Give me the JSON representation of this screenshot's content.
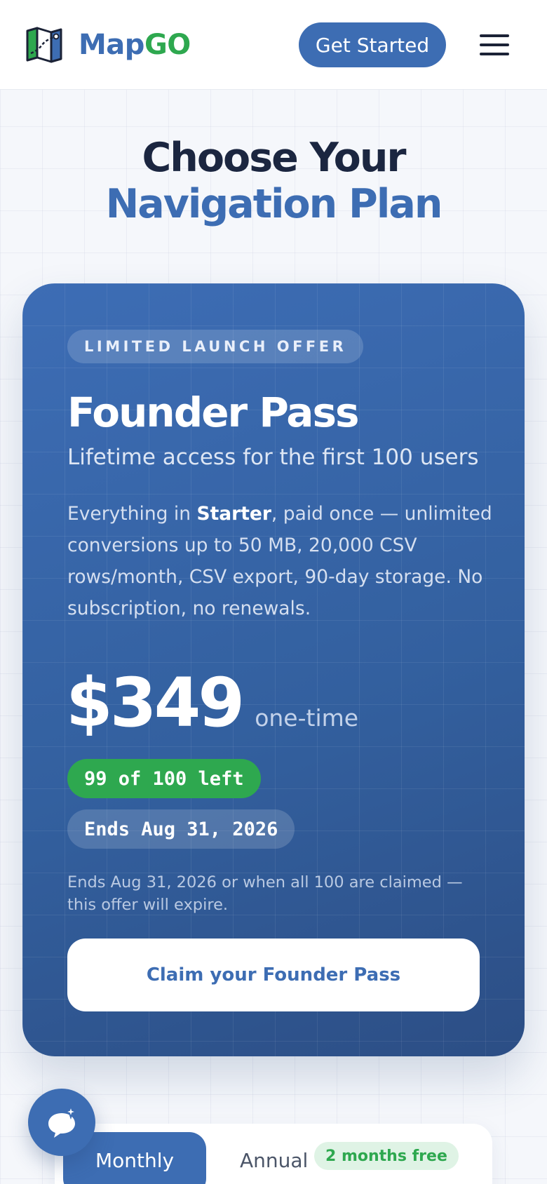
{
  "header": {
    "brand_part1": "Map",
    "brand_part2": "GO",
    "get_started_label": "Get Started"
  },
  "page": {
    "title_part1": "Choose Your ",
    "title_part2": "Navigation Plan"
  },
  "founder_card": {
    "offer_pill": "LIMITED LAUNCH OFFER",
    "title": "Founder Pass",
    "subtitle": "Lifetime access for the first 100 users",
    "desc_prefix": "Everything in ",
    "desc_bold": "Starter",
    "desc_suffix": ", paid once — unlimited conversions up to 50 MB, 20,000 CSV rows/month, CSV export, 90-day storage. No subscription, no renewals.",
    "price": "$349",
    "price_note": "one-time",
    "remaining_badge": "99 of 100 left",
    "ends_badge": "Ends Aug 31, 2026",
    "expire_note": "Ends Aug 31, 2026 or when all 100 are claimed — this offer will expire.",
    "claim_label": "Claim your Founder Pass"
  },
  "billing": {
    "monthly_label": "Monthly",
    "annual_label": "Annual",
    "annual_badge": "2 months free"
  },
  "colors": {
    "brand_blue": "#3d6db3",
    "brand_green": "#2ea84f",
    "heading_dark": "#1b2640"
  },
  "icons": {
    "logo": "folded-map-icon",
    "menu": "hamburger-menu-icon",
    "chat": "chat-sparkle-icon"
  }
}
